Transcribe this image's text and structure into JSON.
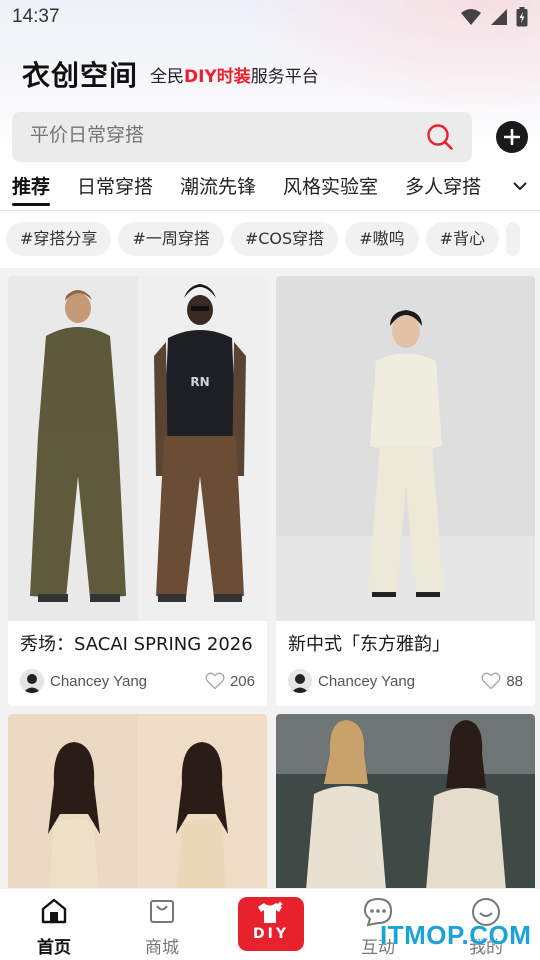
{
  "status_bar": {
    "time": "14:37",
    "icons": [
      "wifi-icon",
      "signal-icon",
      "battery-icon"
    ]
  },
  "header": {
    "logo": "衣创空间",
    "slogan_prefix": "全民",
    "slogan_highlight": "DIY时装",
    "slogan_suffix": "服务平台",
    "accent_color": "#e8222d"
  },
  "search": {
    "placeholder": "平价日常穿搭"
  },
  "tabs": [
    {
      "label": "推荐",
      "active": true
    },
    {
      "label": "日常穿搭"
    },
    {
      "label": "潮流先锋"
    },
    {
      "label": "风格实验室"
    },
    {
      "label": "多人穿搭"
    }
  ],
  "chips": [
    "#穿搭分享",
    "#一周穿搭",
    "#COS穿搭",
    "#嗷呜",
    "#背心"
  ],
  "feed": [
    {
      "title": "秀场：SACAI SPRING 2026",
      "author": "Chancey Yang",
      "likes": "206"
    },
    {
      "title": "新中式「东方雅韵」",
      "author": "Chancey Yang",
      "likes": "88"
    },
    {
      "title": "",
      "author": "",
      "likes": ""
    },
    {
      "title": "",
      "author": "",
      "likes": ""
    }
  ],
  "bottom_nav": [
    {
      "label": "首页",
      "active": true,
      "icon": "home-icon"
    },
    {
      "label": "商城",
      "icon": "shop-bag-icon"
    },
    {
      "label": "DIY",
      "icon": "diy-shirt-icon"
    },
    {
      "label": "互动",
      "icon": "chat-bubble-icon"
    },
    {
      "label": "我的",
      "icon": "smile-face-icon"
    }
  ],
  "watermark": "ITMOP.COM"
}
